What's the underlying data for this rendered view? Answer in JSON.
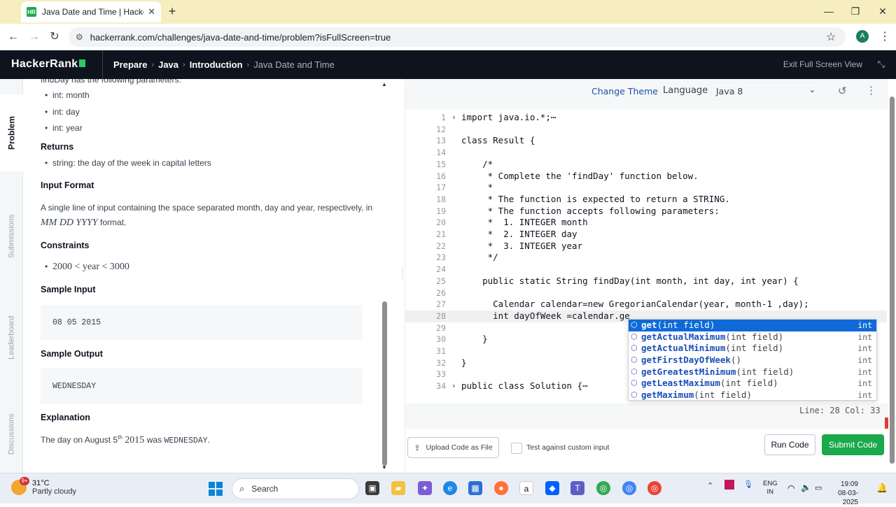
{
  "browser": {
    "tab_title": "Java Date and Time | HackerRank",
    "favicon_text": "HR",
    "url": "hackerrank.com/challenges/java-date-and-time/problem?isFullScreen=true",
    "profile_initial": "A"
  },
  "header": {
    "logo": "HackerRank",
    "crumbs": [
      "Prepare",
      "Java",
      "Introduction",
      "Java Date and Time"
    ],
    "exit_fullscreen": "Exit Full Screen View"
  },
  "vtabs": [
    "Problem",
    "Submissions",
    "Leaderboard",
    "Discussions"
  ],
  "problem": {
    "cut_line": "findDay has the following parameters:",
    "params": [
      "int: month",
      "int: day",
      "int: year"
    ],
    "returns_title": "Returns",
    "returns_item": "string: the day of the week in capital letters",
    "input_format_title": "Input Format",
    "input_format_text": "A single line of input containing the space separated month, day and year, respectively, in",
    "input_format_math": "MM DD YYYY",
    "input_format_suffix": "format.",
    "constraints_title": "Constraints",
    "constraint": "2000 < year < 3000",
    "sample_input_title": "Sample Input",
    "sample_input": "08 05 2015",
    "sample_output_title": "Sample Output",
    "sample_output": "WEDNESDAY",
    "explanation_title": "Explanation",
    "explanation_prefix": "The day on August 5",
    "explanation_sup": "th",
    "explanation_year": " 2015 ",
    "explanation_mid": "was",
    "explanation_day": "WEDNESDAY",
    "explanation_end": "."
  },
  "editor": {
    "change_theme": "Change Theme",
    "language_label": "Language",
    "language_value": "Java 8",
    "status": "Line: 28 Col: 33",
    "lines": [
      {
        "n": "1",
        "t": "import java.io.*;⋯"
      },
      {
        "n": "12",
        "t": ""
      },
      {
        "n": "13",
        "t": "class Result {"
      },
      {
        "n": "14",
        "t": ""
      },
      {
        "n": "15",
        "t": "    /*"
      },
      {
        "n": "16",
        "t": "     * Complete the 'findDay' function below."
      },
      {
        "n": "17",
        "t": "     *"
      },
      {
        "n": "18",
        "t": "     * The function is expected to return a STRING."
      },
      {
        "n": "19",
        "t": "     * The function accepts following parameters:"
      },
      {
        "n": "20",
        "t": "     *  1. INTEGER month"
      },
      {
        "n": "21",
        "t": "     *  2. INTEGER day"
      },
      {
        "n": "22",
        "t": "     *  3. INTEGER year"
      },
      {
        "n": "23",
        "t": "     */"
      },
      {
        "n": "24",
        "t": ""
      },
      {
        "n": "25",
        "t": "    public static String findDay(int month, int day, int year) {"
      },
      {
        "n": "26",
        "t": ""
      },
      {
        "n": "27",
        "t": "      Calendar calendar=new GregorianCalendar(year, month-1 ,day);"
      },
      {
        "n": "28",
        "t": "      int dayOfWeek =calendar.ge"
      },
      {
        "n": "29",
        "t": ""
      },
      {
        "n": "30",
        "t": "    }"
      },
      {
        "n": "31",
        "t": ""
      },
      {
        "n": "32",
        "t": "}"
      },
      {
        "n": "33",
        "t": ""
      },
      {
        "n": "34",
        "t": "public class Solution {⋯"
      }
    ],
    "autocomplete": [
      {
        "name": "get",
        "args": "(int field)",
        "ret": "int"
      },
      {
        "name": "getActualMaximum",
        "args": "(int field)",
        "ret": "int"
      },
      {
        "name": "getActualMinimum",
        "args": "(int field)",
        "ret": "int"
      },
      {
        "name": "getFirstDayOfWeek",
        "args": "()",
        "ret": "int"
      },
      {
        "name": "getGreatestMinimum",
        "args": "(int field)",
        "ret": "int"
      },
      {
        "name": "getLeastMaximum",
        "args": "(int field)",
        "ret": "int"
      },
      {
        "name": "getMaximum",
        "args": "(int field)",
        "ret": "int"
      }
    ]
  },
  "actions": {
    "upload": "Upload Code as File",
    "custom_input": "Test against custom input",
    "run": "Run Code",
    "submit": "Submit Code"
  },
  "taskbar": {
    "weather_temp": "31°C",
    "weather_desc": "Partly cloudy",
    "weather_badge": "9+",
    "search": "Search",
    "lang_top": "ENG",
    "lang_bottom": "IN",
    "time": "19:09",
    "date": "08-03-2025"
  },
  "colors": {
    "brand_green": "#1ba94c",
    "header_bg": "#0e141e",
    "selection_blue": "#0f6ad8"
  }
}
